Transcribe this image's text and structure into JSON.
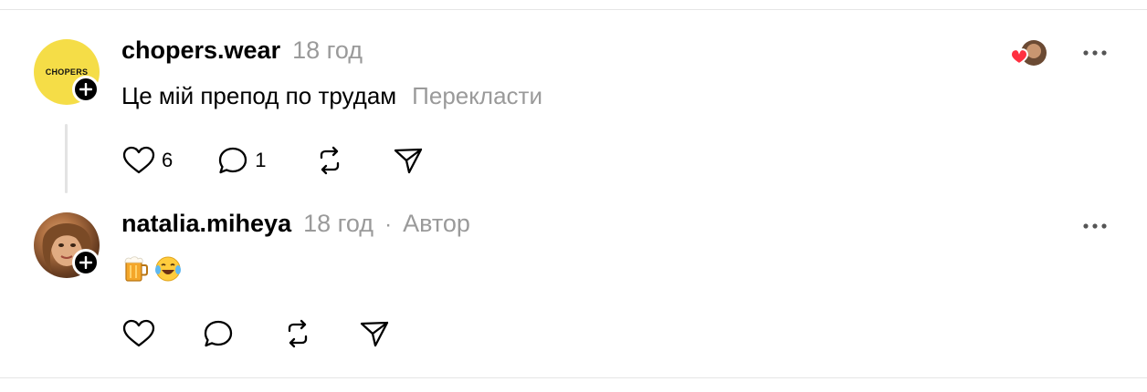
{
  "posts": [
    {
      "username": "chopers.wear",
      "time": "18 год",
      "avatar_logo_text": "CHOPERS",
      "text": "Це мій препод по трудам",
      "translate_label": "Перекласти",
      "likes": "6",
      "comments": "1",
      "icons": [
        "heart-icon",
        "comment-icon",
        "repost-icon",
        "share-icon",
        "more-icon",
        "follow-plus-icon"
      ]
    },
    {
      "username": "natalia.miheya",
      "time": "18 год",
      "separator": "·",
      "author_badge": "Автор",
      "emojis": [
        "beer-mug-emoji",
        "tears-of-joy-emoji"
      ],
      "icons": [
        "heart-icon",
        "comment-icon",
        "repost-icon",
        "share-icon",
        "more-icon",
        "follow-plus-icon"
      ]
    }
  ],
  "colors": {
    "muted_text": "#9a9a9a",
    "divider": "#e5e5e5",
    "chopers_avatar_bg": "#f5dd47",
    "like_heart_red": "#ff3040"
  }
}
